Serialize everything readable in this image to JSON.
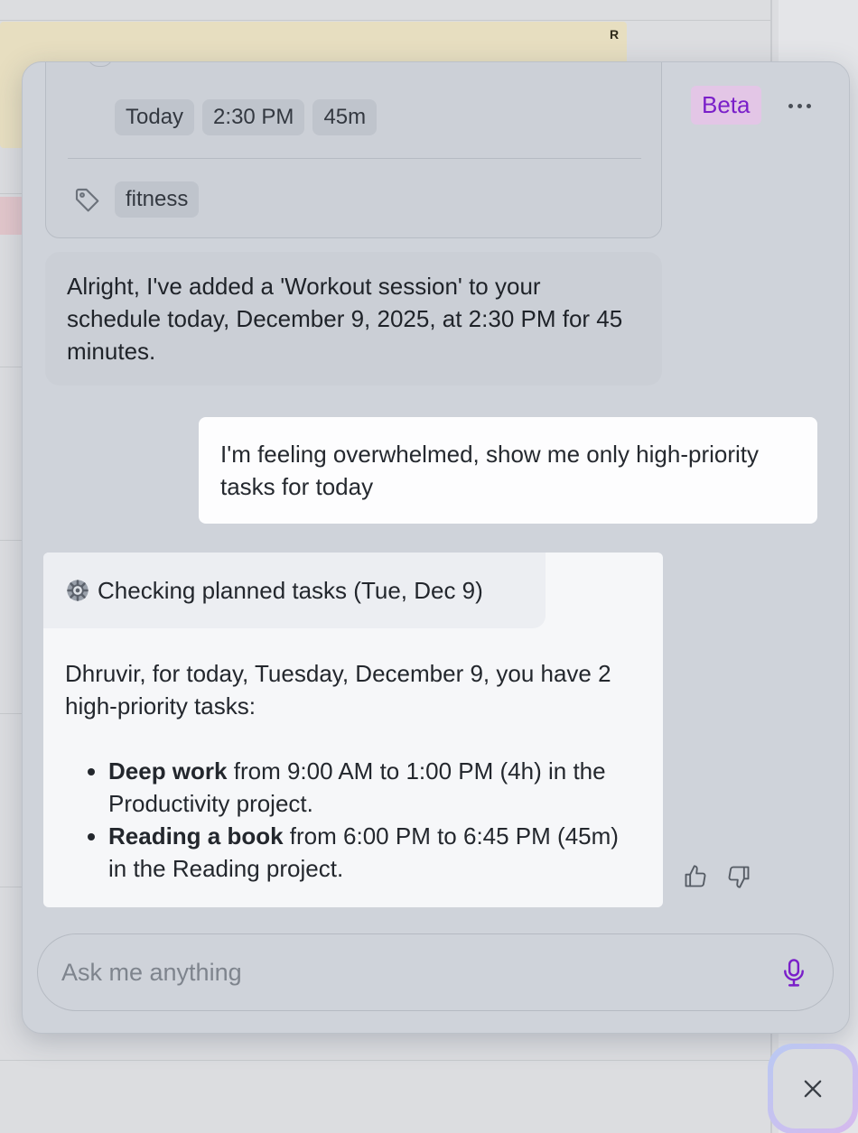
{
  "background": {
    "event_letter": "R"
  },
  "header": {
    "badge": "Beta"
  },
  "event_card": {
    "chips": [
      "Today",
      "2:30 PM",
      "45m"
    ],
    "tag": "fitness"
  },
  "messages": {
    "assistant_prev": "Alright, I've added a 'Workout session' to your schedule today, December 9, 2025, at 2:30 PM for 45 minutes.",
    "user": "I'm feeling overwhelmed, show me only high-priority tasks for today",
    "tool_status": "Checking planned tasks (Tue, Dec 9)",
    "reply_intro": "Dhruvir, for today, Tuesday, December 9, you have 2 high-priority tasks:",
    "tasks": [
      {
        "title": "Deep work",
        "detail": " from 9:00 AM to 1:00 PM (4h) in the Productivity project."
      },
      {
        "title": "Reading a book",
        "detail": " from 6:00 PM to 6:45 PM (45m) in the Reading project."
      }
    ]
  },
  "input": {
    "placeholder": "Ask me anything"
  },
  "colors": {
    "accent_purple": "#7a1fc9",
    "user_bubble": "#fdfdfe",
    "panel_bg": "#cfd3da"
  }
}
